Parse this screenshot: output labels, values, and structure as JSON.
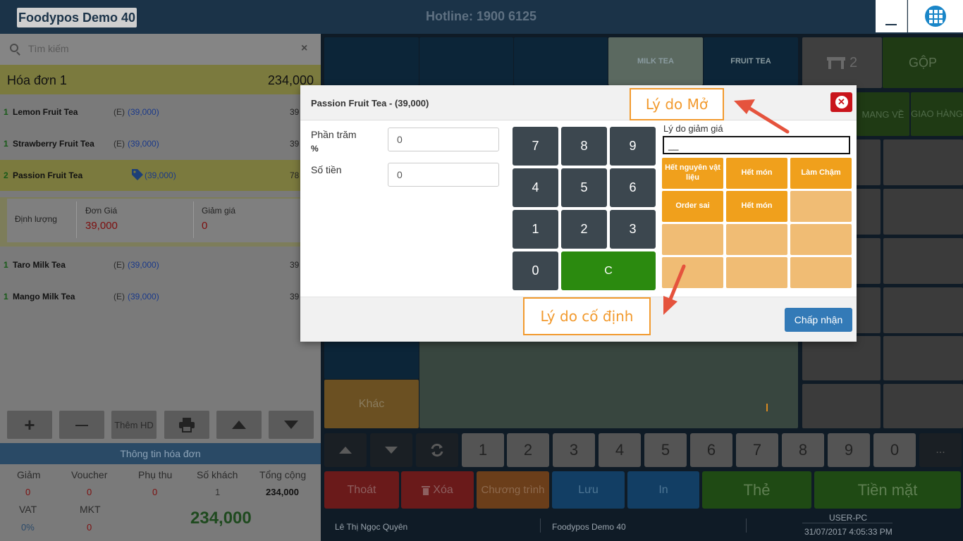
{
  "topbar": {
    "brand": "Foodypos Demo 40",
    "hotline": "Hotline: 1900 6125",
    "minimize": "_"
  },
  "search": {
    "placeholder": "Tìm kiếm",
    "clear": "×"
  },
  "bill": {
    "title": "Hóa đơn 1",
    "total": "234,000",
    "items": [
      {
        "qty": "1",
        "name": "Lemon Fruit Tea",
        "tag": "(E)",
        "price": "(39,000)",
        "amount": "39"
      },
      {
        "qty": "1",
        "name": "Strawberry Fruit Tea",
        "tag": "(E)",
        "price": "(39,000)",
        "amount": "39"
      },
      {
        "qty": "2",
        "name": "Passion Fruit Tea",
        "tag": "",
        "price": "(39,000)",
        "amount": "78"
      },
      {
        "qty": "1",
        "name": "Taro Milk Tea",
        "tag": "(E)",
        "price": "(39,000)",
        "amount": "39"
      },
      {
        "qty": "1",
        "name": "Mango Milk Tea",
        "tag": "(E)",
        "price": "(39,000)",
        "amount": "39"
      }
    ],
    "detail": {
      "label": "Định lượng",
      "unit_price_label": "Đơn Giá",
      "unit_price": "39,000",
      "discount_label": "Giảm giá",
      "discount": "0"
    }
  },
  "toolbar": {
    "plus": "+",
    "minus": "—",
    "add_bill": "Thêm HD"
  },
  "info": {
    "header": "Thông tin hóa đơn",
    "discount_label": "Giảm",
    "discount": "0",
    "voucher_label": "Voucher",
    "voucher": "0",
    "surcharge_label": "Phụ thu",
    "surcharge": "0",
    "guests_label": "Số khách",
    "guests": "1",
    "total_label": "Tổng cộng",
    "total": "234,000",
    "vat_label": "VAT",
    "vat": "0%",
    "mkt_label": "MKT",
    "mkt": "0",
    "grand_total": "234,000"
  },
  "categories": {
    "milk_tea": "MILK TEA",
    "fruit_tea": "FRUIT TEA",
    "other": "Khác"
  },
  "right_panel": {
    "table_count": "2",
    "merge": "GỘP",
    "takeaway": "MANG VỀ",
    "delivery": "GIAO HÀNG"
  },
  "numbar": [
    "1",
    "2",
    "3",
    "4",
    "5",
    "6",
    "7",
    "8",
    "9",
    "0",
    "..."
  ],
  "actions": {
    "exit": "Thoát",
    "delete": "Xóa",
    "program": "Chương trình",
    "save": "Lưu",
    "print": "In",
    "card": "Thẻ",
    "cash": "Tiền mặt"
  },
  "footer": {
    "user": "Lê Thị Ngọc Quyên",
    "store": "Foodypos Demo 40",
    "pc": "USER-PC",
    "datetime": "31/07/2017 4:05:33 PM"
  },
  "modal": {
    "title": "Passion Fruit Tea - (39,000)",
    "percent_label": "Phần trăm",
    "percent_unit": "%",
    "percent_value": "0",
    "amount_label": "Số tiền",
    "amount_value": "0",
    "keypad": [
      "7",
      "8",
      "9",
      "4",
      "5",
      "6",
      "1",
      "2",
      "3",
      "0",
      "C"
    ],
    "reason_label": "Lý do giảm giá",
    "reason_value": "__",
    "reasons": [
      "Hết nguyên vật liệu",
      "Hết món",
      "Làm Chậm",
      "Order sai",
      "Hết món"
    ],
    "accept": "Chấp nhận"
  },
  "annotations": {
    "open_reason": "Lý do Mở",
    "fixed_reason": "Lý do cố định"
  },
  "colors": {
    "accent_green": "#2b8a0f",
    "accent_red": "#c9141b",
    "accent_orange": "#f0a01c",
    "accent_blue": "#337ab7"
  }
}
